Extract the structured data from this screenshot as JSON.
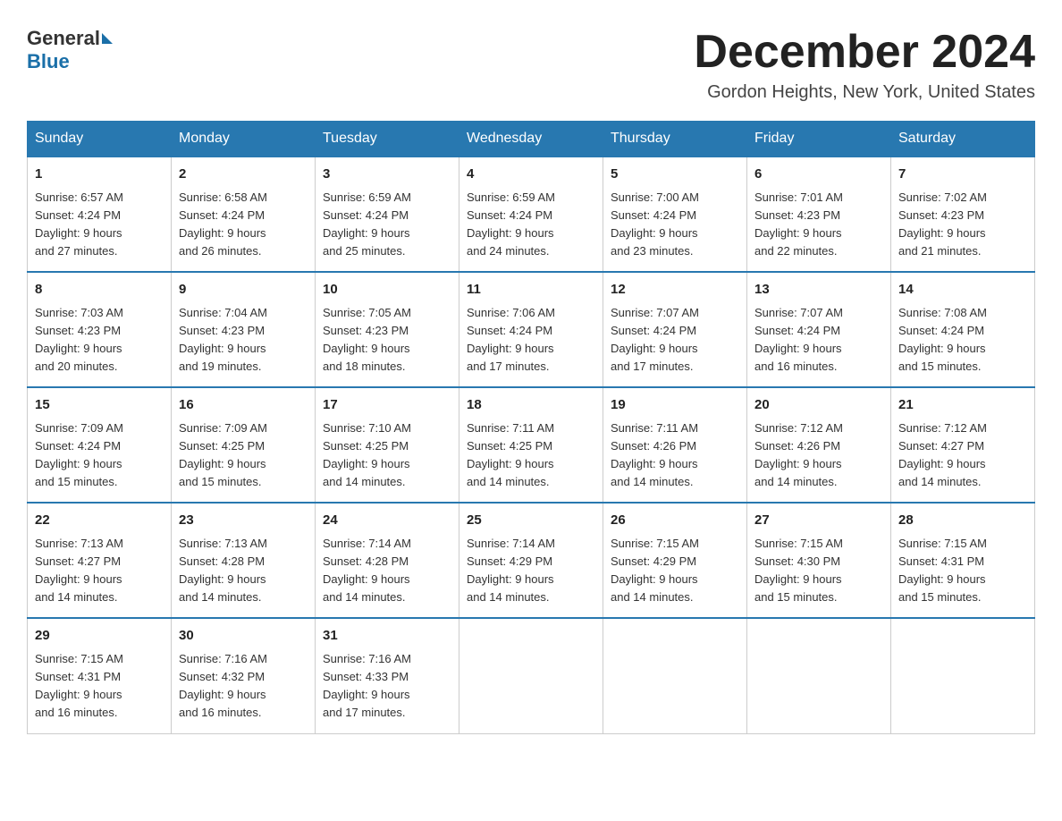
{
  "header": {
    "logo_general": "General",
    "logo_blue": "Blue",
    "month_year": "December 2024",
    "location": "Gordon Heights, New York, United States"
  },
  "days_of_week": [
    "Sunday",
    "Monday",
    "Tuesday",
    "Wednesday",
    "Thursday",
    "Friday",
    "Saturday"
  ],
  "weeks": [
    [
      {
        "day": "1",
        "sunrise": "6:57 AM",
        "sunset": "4:24 PM",
        "daylight": "9 hours and 27 minutes."
      },
      {
        "day": "2",
        "sunrise": "6:58 AM",
        "sunset": "4:24 PM",
        "daylight": "9 hours and 26 minutes."
      },
      {
        "day": "3",
        "sunrise": "6:59 AM",
        "sunset": "4:24 PM",
        "daylight": "9 hours and 25 minutes."
      },
      {
        "day": "4",
        "sunrise": "6:59 AM",
        "sunset": "4:24 PM",
        "daylight": "9 hours and 24 minutes."
      },
      {
        "day": "5",
        "sunrise": "7:00 AM",
        "sunset": "4:24 PM",
        "daylight": "9 hours and 23 minutes."
      },
      {
        "day": "6",
        "sunrise": "7:01 AM",
        "sunset": "4:23 PM",
        "daylight": "9 hours and 22 minutes."
      },
      {
        "day": "7",
        "sunrise": "7:02 AM",
        "sunset": "4:23 PM",
        "daylight": "9 hours and 21 minutes."
      }
    ],
    [
      {
        "day": "8",
        "sunrise": "7:03 AM",
        "sunset": "4:23 PM",
        "daylight": "9 hours and 20 minutes."
      },
      {
        "day": "9",
        "sunrise": "7:04 AM",
        "sunset": "4:23 PM",
        "daylight": "9 hours and 19 minutes."
      },
      {
        "day": "10",
        "sunrise": "7:05 AM",
        "sunset": "4:23 PM",
        "daylight": "9 hours and 18 minutes."
      },
      {
        "day": "11",
        "sunrise": "7:06 AM",
        "sunset": "4:24 PM",
        "daylight": "9 hours and 17 minutes."
      },
      {
        "day": "12",
        "sunrise": "7:07 AM",
        "sunset": "4:24 PM",
        "daylight": "9 hours and 17 minutes."
      },
      {
        "day": "13",
        "sunrise": "7:07 AM",
        "sunset": "4:24 PM",
        "daylight": "9 hours and 16 minutes."
      },
      {
        "day": "14",
        "sunrise": "7:08 AM",
        "sunset": "4:24 PM",
        "daylight": "9 hours and 15 minutes."
      }
    ],
    [
      {
        "day": "15",
        "sunrise": "7:09 AM",
        "sunset": "4:24 PM",
        "daylight": "9 hours and 15 minutes."
      },
      {
        "day": "16",
        "sunrise": "7:09 AM",
        "sunset": "4:25 PM",
        "daylight": "9 hours and 15 minutes."
      },
      {
        "day": "17",
        "sunrise": "7:10 AM",
        "sunset": "4:25 PM",
        "daylight": "9 hours and 14 minutes."
      },
      {
        "day": "18",
        "sunrise": "7:11 AM",
        "sunset": "4:25 PM",
        "daylight": "9 hours and 14 minutes."
      },
      {
        "day": "19",
        "sunrise": "7:11 AM",
        "sunset": "4:26 PM",
        "daylight": "9 hours and 14 minutes."
      },
      {
        "day": "20",
        "sunrise": "7:12 AM",
        "sunset": "4:26 PM",
        "daylight": "9 hours and 14 minutes."
      },
      {
        "day": "21",
        "sunrise": "7:12 AM",
        "sunset": "4:27 PM",
        "daylight": "9 hours and 14 minutes."
      }
    ],
    [
      {
        "day": "22",
        "sunrise": "7:13 AM",
        "sunset": "4:27 PM",
        "daylight": "9 hours and 14 minutes."
      },
      {
        "day": "23",
        "sunrise": "7:13 AM",
        "sunset": "4:28 PM",
        "daylight": "9 hours and 14 minutes."
      },
      {
        "day": "24",
        "sunrise": "7:14 AM",
        "sunset": "4:28 PM",
        "daylight": "9 hours and 14 minutes."
      },
      {
        "day": "25",
        "sunrise": "7:14 AM",
        "sunset": "4:29 PM",
        "daylight": "9 hours and 14 minutes."
      },
      {
        "day": "26",
        "sunrise": "7:15 AM",
        "sunset": "4:29 PM",
        "daylight": "9 hours and 14 minutes."
      },
      {
        "day": "27",
        "sunrise": "7:15 AM",
        "sunset": "4:30 PM",
        "daylight": "9 hours and 15 minutes."
      },
      {
        "day": "28",
        "sunrise": "7:15 AM",
        "sunset": "4:31 PM",
        "daylight": "9 hours and 15 minutes."
      }
    ],
    [
      {
        "day": "29",
        "sunrise": "7:15 AM",
        "sunset": "4:31 PM",
        "daylight": "9 hours and 16 minutes."
      },
      {
        "day": "30",
        "sunrise": "7:16 AM",
        "sunset": "4:32 PM",
        "daylight": "9 hours and 16 minutes."
      },
      {
        "day": "31",
        "sunrise": "7:16 AM",
        "sunset": "4:33 PM",
        "daylight": "9 hours and 17 minutes."
      },
      null,
      null,
      null,
      null
    ]
  ],
  "labels": {
    "sunrise": "Sunrise:",
    "sunset": "Sunset:",
    "daylight": "Daylight:"
  }
}
